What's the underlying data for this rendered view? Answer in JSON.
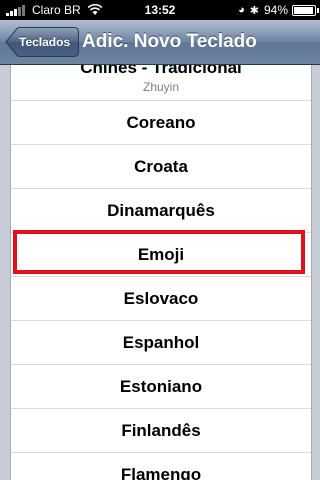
{
  "status_bar": {
    "carrier": "Claro BR",
    "time": "13:52",
    "battery_percent": "94%",
    "battery_level": 0.94,
    "icons": [
      "signal-icon",
      "wifi-icon",
      "lock-rotation-icon",
      "bluetooth-icon",
      "battery-icon"
    ]
  },
  "nav": {
    "back_label": "Teclados",
    "title": "Adic. Novo Teclado"
  },
  "list": {
    "items": [
      {
        "label": "Chinês - Tradicional",
        "subtitle": "Zhuyin"
      },
      {
        "label": "Coreano"
      },
      {
        "label": "Croata"
      },
      {
        "label": "Dinamarquês"
      },
      {
        "label": "Emoji",
        "highlighted": true
      },
      {
        "label": "Eslovaco"
      },
      {
        "label": "Espanhol"
      },
      {
        "label": "Estoniano"
      },
      {
        "label": "Finlandês"
      },
      {
        "label": "Flamengo"
      }
    ]
  },
  "colors": {
    "highlight_border": "#e0101e",
    "nav_gradient_mid": "#6d83a3",
    "background": "#c7ccd7"
  }
}
